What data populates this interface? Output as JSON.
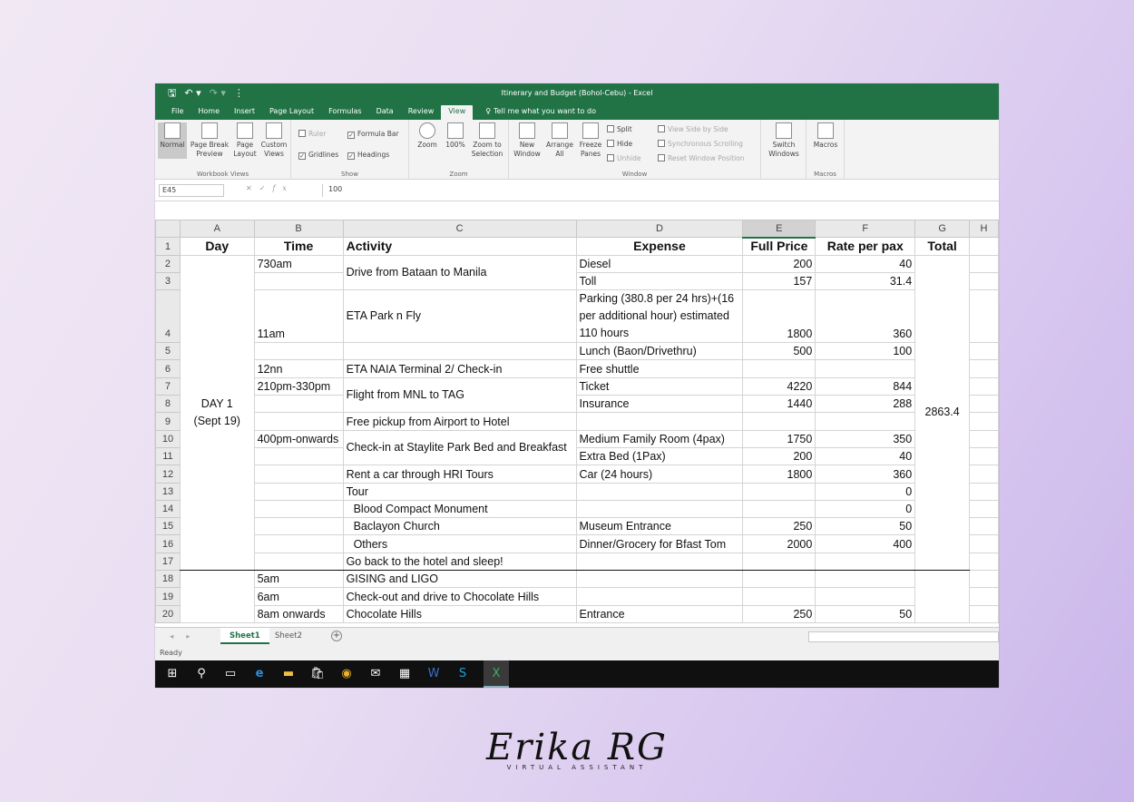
{
  "window": {
    "title": "Itinerary and Budget (Bohol-Cebu) - Excel"
  },
  "qat": {
    "save": "🖫",
    "undo": "↶ ▾",
    "redo": "↷ ▾",
    "customize": "⋮"
  },
  "tabs": [
    "File",
    "Home",
    "Insert",
    "Page Layout",
    "Formulas",
    "Data",
    "Review",
    "View"
  ],
  "active_tab": "View",
  "tell_me": "Tell me what you want to do",
  "ribbon": {
    "workbook_views": {
      "label": "Workbook Views",
      "normal": "Normal",
      "page_break": "Page Break Preview",
      "page_layout": "Page Layout",
      "custom": "Custom Views"
    },
    "show": {
      "label": "Show",
      "ruler": "Ruler",
      "formula_bar": "Formula Bar",
      "gridlines": "Gridlines",
      "headings": "Headings"
    },
    "zoom": {
      "label": "Zoom",
      "zoom": "Zoom",
      "hundred": "100%",
      "zoom_sel": "Zoom to Selection"
    },
    "window": {
      "label": "Window",
      "new": "New Window",
      "arrange": "Arrange All",
      "freeze": "Freeze Panes",
      "split": "Split",
      "hide": "Hide",
      "unhide": "Unhide",
      "side": "View Side by Side",
      "sync": "Synchronous Scrolling",
      "reset": "Reset Window Position",
      "switch": "Switch Windows"
    },
    "macros": {
      "label": "Macros",
      "macros": "Macros"
    }
  },
  "formula_bar": {
    "name_box": "E45",
    "value": "100"
  },
  "columns": [
    "A",
    "B",
    "C",
    "D",
    "E",
    "F",
    "G",
    "H"
  ],
  "header_row": {
    "day": "Day",
    "time": "Time",
    "activity": "Activity",
    "expense": "Expense",
    "full_price": "Full Price",
    "rate": "Rate per pax",
    "total": "Total"
  },
  "day1": {
    "line1": "DAY 1",
    "line2": "(Sept 19)",
    "total": "2863.4"
  },
  "rows": {
    "r2": {
      "time": "730am",
      "activity": "Drive from Bataan to Manila",
      "expense": "Diesel",
      "price": "200",
      "rate": "40"
    },
    "r3": {
      "expense": "Toll",
      "price": "157",
      "rate": "31.4"
    },
    "r4": {
      "time": "11am",
      "activity": "ETA Park n Fly",
      "expense": "Parking (380.8 per 24 hrs)+(16 per additional hour) estimated 110 hours",
      "price": "1800",
      "rate": "360"
    },
    "r5": {
      "expense": "Lunch (Baon/Drivethru)",
      "price": "500",
      "rate": "100"
    },
    "r6": {
      "time": "12nn",
      "activity": "ETA NAIA Terminal 2/ Check-in",
      "expense": "Free shuttle"
    },
    "r7": {
      "time": "210pm-330pm",
      "activity": "Flight from MNL to TAG",
      "expense": "Ticket",
      "price": "4220",
      "rate": "844"
    },
    "r8": {
      "expense": "Insurance",
      "price": "1440",
      "rate": "288"
    },
    "r9": {
      "activity": "Free pickup from Airport to Hotel"
    },
    "r10": {
      "time": "400pm-onwards",
      "activity": "Check-in at Staylite Park Bed and Breakfast",
      "expense": "Medium Family Room (4pax)",
      "price": "1750",
      "rate": "350"
    },
    "r11": {
      "expense": "Extra Bed (1Pax)",
      "price": "200",
      "rate": "40"
    },
    "r12": {
      "activity": "Rent a car through HRI Tours",
      "expense": "Car (24 hours)",
      "price": "1800",
      "rate": "360"
    },
    "r13": {
      "activity": "Tour",
      "rate": "0"
    },
    "r14": {
      "activity": "Blood Compact Monument",
      "rate": "0"
    },
    "r15": {
      "activity": "Baclayon Church",
      "expense": "Museum Entrance",
      "price": "250",
      "rate": "50"
    },
    "r16": {
      "activity": "Others",
      "expense": "Dinner/Grocery for Bfast Tom",
      "price": "2000",
      "rate": "400"
    },
    "r17": {
      "activity": "Go back to the hotel and sleep!"
    },
    "r18": {
      "time": "5am",
      "activity": "GISING and LIGO"
    },
    "r19": {
      "time": "6am",
      "activity": "Check-out and drive to Chocolate Hills"
    },
    "r20": {
      "time": "8am onwards",
      "activity": "Chocolate Hills",
      "expense": "Entrance",
      "price": "250",
      "rate": "50"
    }
  },
  "row_numbers": [
    "1",
    "2",
    "3",
    "4",
    "5",
    "6",
    "7",
    "8",
    "9",
    "10",
    "11",
    "12",
    "13",
    "14",
    "15",
    "16",
    "17",
    "18",
    "19",
    "20"
  ],
  "sheets": [
    "Sheet1",
    "Sheet2"
  ],
  "active_sheet": "Sheet1",
  "add_sheet": "+",
  "status": "Ready",
  "taskbar": [
    "windows-icon",
    "search-icon",
    "task-view-icon",
    "edge-icon",
    "file-explorer-icon",
    "store-icon",
    "chrome-icon",
    "mail-icon",
    "calculator-icon",
    "word-icon",
    "skype-icon",
    "excel-icon"
  ],
  "brand": {
    "signature": "Erika RG",
    "tagline": "VIRTUAL ASSISTANT"
  }
}
